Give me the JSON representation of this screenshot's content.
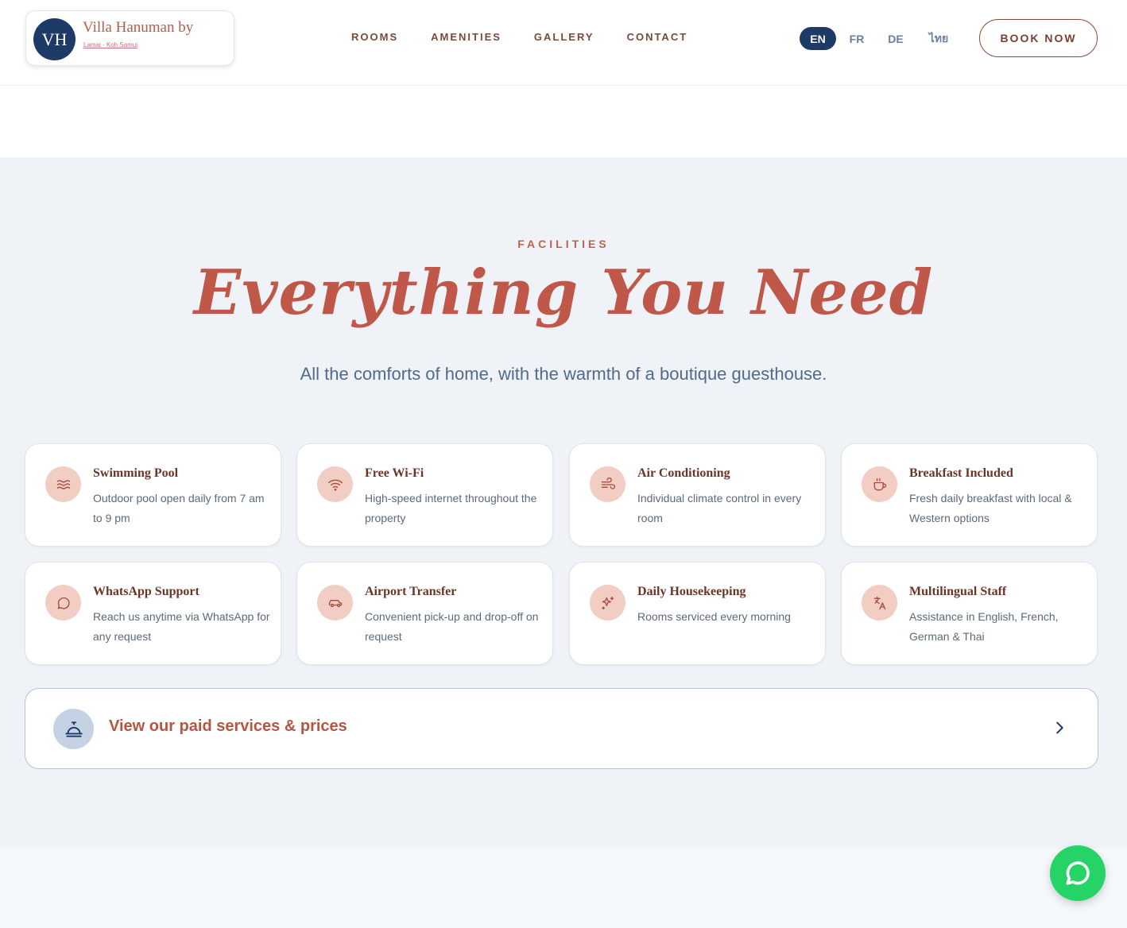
{
  "brand": {
    "monogram": "VH",
    "name": "Villa Hanuman by",
    "tagline": "Lamai · Koh Samui"
  },
  "nav": {
    "items": [
      {
        "label": "ROOMS"
      },
      {
        "label": "AMENITIES"
      },
      {
        "label": "GALLERY"
      },
      {
        "label": "CONTACT"
      }
    ]
  },
  "languages": {
    "items": [
      {
        "label": "EN",
        "active": true
      },
      {
        "label": "FR",
        "active": false
      },
      {
        "label": "DE",
        "active": false
      },
      {
        "label": "ไทย",
        "active": false
      }
    ]
  },
  "header": {
    "book_label": "BOOK NOW"
  },
  "facilities": {
    "eyebrow": "FACILITIES",
    "title": "Everything You Need",
    "subtitle": "All the comforts of home, with the warmth of a boutique guesthouse.",
    "cards": [
      {
        "icon": "waves-icon",
        "title": "Swimming Pool",
        "desc": "Outdoor pool open daily from 7 am to 9 pm"
      },
      {
        "icon": "wifi-icon",
        "title": "Free Wi-Fi",
        "desc": "High-speed internet throughout the property"
      },
      {
        "icon": "wind-icon",
        "title": "Air Conditioning",
        "desc": "Individual climate control in every room"
      },
      {
        "icon": "coffee-icon",
        "title": "Breakfast Included",
        "desc": "Fresh daily breakfast with local & Western options"
      },
      {
        "icon": "message-icon",
        "title": "WhatsApp Support",
        "desc": "Reach us anytime via WhatsApp for any request"
      },
      {
        "icon": "car-icon",
        "title": "Airport Transfer",
        "desc": "Convenient pick-up and drop-off on request"
      },
      {
        "icon": "sparkles-icon",
        "title": "Daily Housekeeping",
        "desc": "Rooms serviced every morning"
      },
      {
        "icon": "translate-icon",
        "title": "Multilingual Staff",
        "desc": "Assistance in English, French, German & Thai"
      }
    ],
    "services_label": "View our paid services & prices"
  },
  "colors": {
    "accent": "#c0584a",
    "navy": "#1e3a66",
    "icon_bg": "#f2cdc4",
    "whatsapp": "#25d366"
  }
}
